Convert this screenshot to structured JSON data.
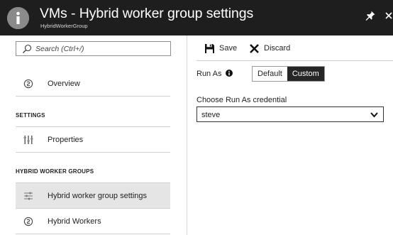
{
  "header": {
    "title": "VMs - Hybrid worker group settings",
    "subtitle": "HybridWorkerGroup",
    "icon": "info-circle-icon",
    "pin_icon": "pin-icon",
    "close_icon": "close-icon"
  },
  "sidebar": {
    "search": {
      "placeholder": "Search (Ctrl+/)"
    },
    "overview": {
      "label": "Overview",
      "icon": "overview-icon"
    },
    "sections": [
      {
        "title": "SETTINGS",
        "items": [
          {
            "label": "Properties",
            "icon": "properties-icon"
          }
        ]
      },
      {
        "title": "HYBRID WORKER GROUPS",
        "items": [
          {
            "label": "Hybrid worker group settings",
            "icon": "settings-sliders-icon",
            "active": true
          },
          {
            "label": "Hybrid Workers",
            "icon": "hybrid-workers-icon"
          }
        ]
      }
    ]
  },
  "toolbar": {
    "save_label": "Save",
    "discard_label": "Discard"
  },
  "form": {
    "run_as_label": "Run As",
    "run_as_options": [
      "Default",
      "Custom"
    ],
    "run_as_selected": "Custom",
    "credential_label": "Choose Run As credential",
    "credential_value": "steve"
  },
  "colors": {
    "header_bg": "#1e1e1e",
    "active_item_bg": "#e5e5e5",
    "toggle_selected_bg": "#262626"
  }
}
